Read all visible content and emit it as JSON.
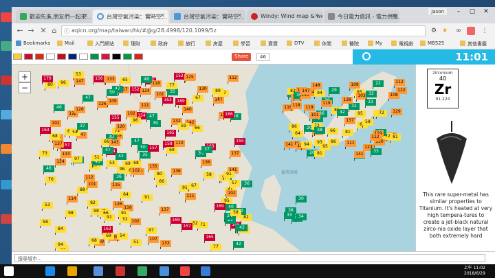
{
  "browser": {
    "tabs": [
      {
        "title": "歡迎先進,朋友們—起來..."
      },
      {
        "title": "台灣空氣污染：實時空..."
      },
      {
        "title": "台灣空氣污染：實時空..."
      },
      {
        "title": "Windy: Wind map & we..."
      },
      {
        "title": "今日電力資訊 - 電力供應..."
      }
    ],
    "user": "Jason",
    "url": "aqicn.org/map/taiwan/hk/#@g/28.4998/120.1099/5z",
    "bookmarks": [
      "Bookmarks",
      "Mail",
      "入門網站",
      "理財",
      "政府",
      "旅行",
      "房屋",
      "學習",
      "寶寶",
      "DTV",
      "休閒",
      "醫院",
      "My",
      "電視劇",
      "MB525"
    ],
    "other_bookmarks": "其他書籤"
  },
  "aqi": {
    "share_label": "Share",
    "share_count": "46",
    "clock": "11:01",
    "map_labels": [
      {
        "text": "臺灣海峽"
      }
    ],
    "search_placeholder": "搜尋城市..."
  },
  "panel": {
    "element_name": "zirconium",
    "element_number": "40",
    "element_symbol": "Zr",
    "element_mass": "91.224",
    "text": "This rare super-metal has similar properties to Titanium. It's heated at very high tempera-tures to create a jet-black natural zirco-nia oxide layer that both extremely hard"
  },
  "taskbar": {
    "time": "上午 11:02",
    "date": "2018/6/29"
  }
}
